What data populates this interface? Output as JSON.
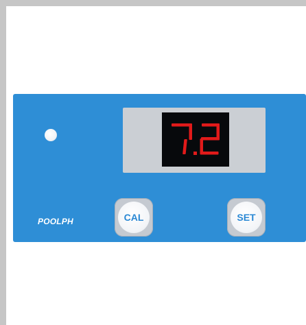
{
  "device": {
    "brand_label": "POOLPH",
    "display_value": "7.2",
    "buttons": {
      "cal_label": "CAL",
      "set_label": "SET"
    }
  },
  "colors": {
    "panel": "#2e8ed6",
    "display_segment": "#e11a1a",
    "display_background": "#07090c",
    "frame_border": "#c6c6c6",
    "button_text": "#2a88d4"
  },
  "icons": {
    "status_led": "led-indicator-icon"
  }
}
